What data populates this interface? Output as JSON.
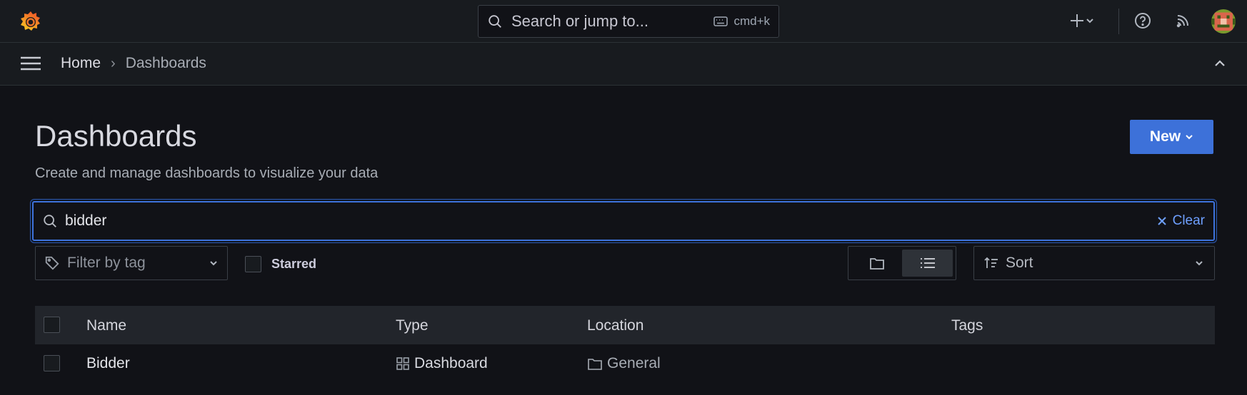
{
  "topbar": {
    "search_placeholder": "Search or jump to...",
    "shortcut": "cmd+k"
  },
  "breadcrumb": {
    "home": "Home",
    "separator": "›",
    "current": "Dashboards"
  },
  "page": {
    "title": "Dashboards",
    "subtitle": "Create and manage dashboards to visualize your data",
    "new_button": "New"
  },
  "search": {
    "value": "bidder",
    "clear_label": "Clear"
  },
  "filters": {
    "tag_placeholder": "Filter by tag",
    "starred_label": "Starred",
    "sort_placeholder": "Sort"
  },
  "table": {
    "columns": [
      "Name",
      "Type",
      "Location",
      "Tags"
    ],
    "rows": [
      {
        "name": "Bidder",
        "type": "Dashboard",
        "location": "General",
        "tags": ""
      }
    ]
  },
  "colors": {
    "primary": "#3d71d9",
    "link": "#6e9fff",
    "background": "#111217",
    "panel": "#181b1f"
  }
}
